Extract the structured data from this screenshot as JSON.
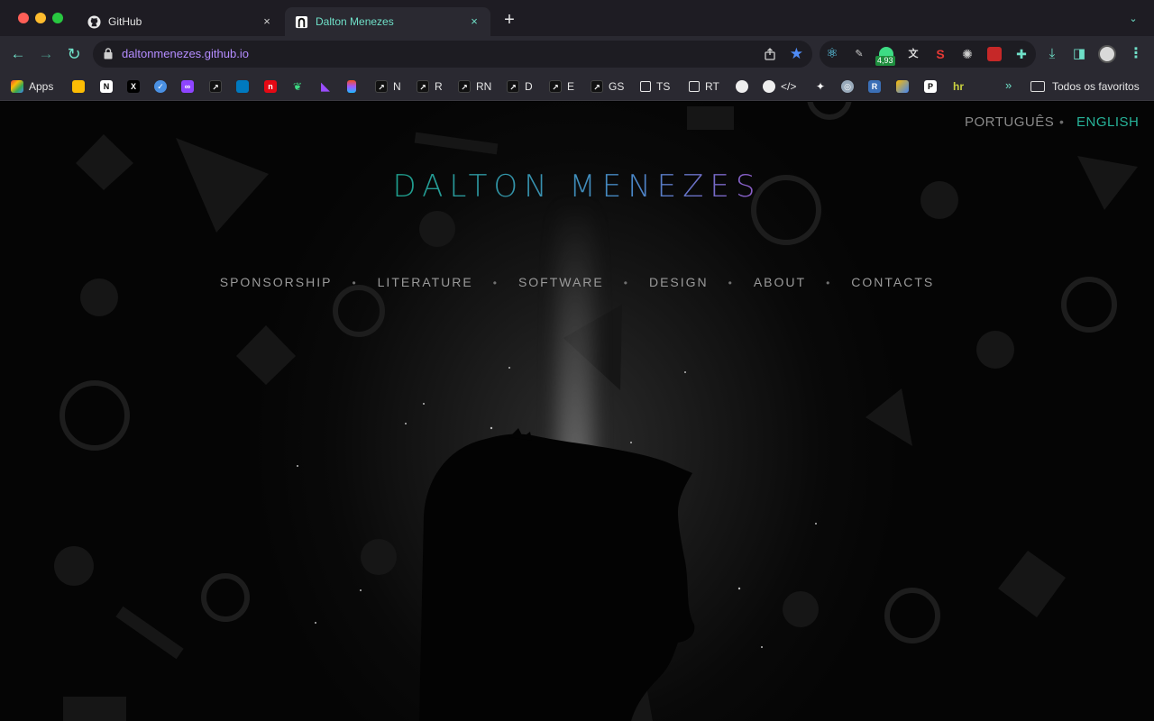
{
  "browser": {
    "tabs": [
      {
        "title": "GitHub",
        "favicon": "github-icon",
        "close": "×",
        "active": false
      },
      {
        "title": "Dalton Menezes",
        "favicon": "site-logo-icon",
        "close": "×",
        "active": true
      }
    ],
    "new_tab": "+",
    "tab_search": "⌄",
    "url": "daltonmenezes.github.io",
    "extension_badge": "4,93",
    "accent_color": "#6fe0c8",
    "url_color": "#b48cff"
  },
  "bookmarks": {
    "items": [
      {
        "label": "Apps",
        "icon": "apps-grid-icon"
      },
      {
        "label": "",
        "icon": "keep-icon"
      },
      {
        "label": "",
        "icon": "notion-icon"
      },
      {
        "label": "",
        "icon": "x-icon"
      },
      {
        "label": "",
        "icon": "check-icon"
      },
      {
        "label": "",
        "icon": "loop-icon"
      },
      {
        "label": "",
        "icon": "shortcut-icon"
      },
      {
        "label": "",
        "icon": "trello-icon"
      },
      {
        "label": "",
        "icon": "netflix-icon"
      },
      {
        "label": "",
        "icon": "leaf-icon"
      },
      {
        "label": "",
        "icon": "kotlin-icon"
      },
      {
        "label": "",
        "icon": "figma-icon"
      },
      {
        "label": "N",
        "icon": "shortcut-icon"
      },
      {
        "label": "R",
        "icon": "shortcut-icon"
      },
      {
        "label": "RN",
        "icon": "shortcut-icon"
      },
      {
        "label": "D",
        "icon": "shortcut-icon"
      },
      {
        "label": "E",
        "icon": "shortcut-icon"
      },
      {
        "label": "GS",
        "icon": "shortcut-icon"
      },
      {
        "label": "TS",
        "icon": "page-icon"
      },
      {
        "label": "RT",
        "icon": "page-icon"
      },
      {
        "label": "",
        "icon": "github-icon"
      },
      {
        "label": "</>",
        "icon": "github-icon"
      },
      {
        "label": "",
        "icon": "bird-icon"
      },
      {
        "label": "",
        "icon": "swirl-icon"
      },
      {
        "label": "",
        "icon": "r-icon"
      },
      {
        "label": "",
        "icon": "ads-icon"
      },
      {
        "label": "",
        "icon": "patreon-icon"
      },
      {
        "label": "",
        "icon": "hr-icon"
      }
    ],
    "more": "»",
    "folder_label": "Todos os favoritos"
  },
  "page": {
    "languages": {
      "portuguese": "PORTUGUÊS",
      "separator": "•",
      "english": "ENGLISH",
      "active": "ENGLISH"
    },
    "title": "DALTON MENEZES",
    "nav": [
      "SPONSORSHIP",
      "LITERATURE",
      "SOFTWARE",
      "DESIGN",
      "ABOUT",
      "CONTACTS"
    ],
    "nav_separator": "•",
    "colors": {
      "title_teal": "#1f9f8e",
      "title_violet": "#8a5ec8",
      "active_language": "#27b49a"
    }
  }
}
